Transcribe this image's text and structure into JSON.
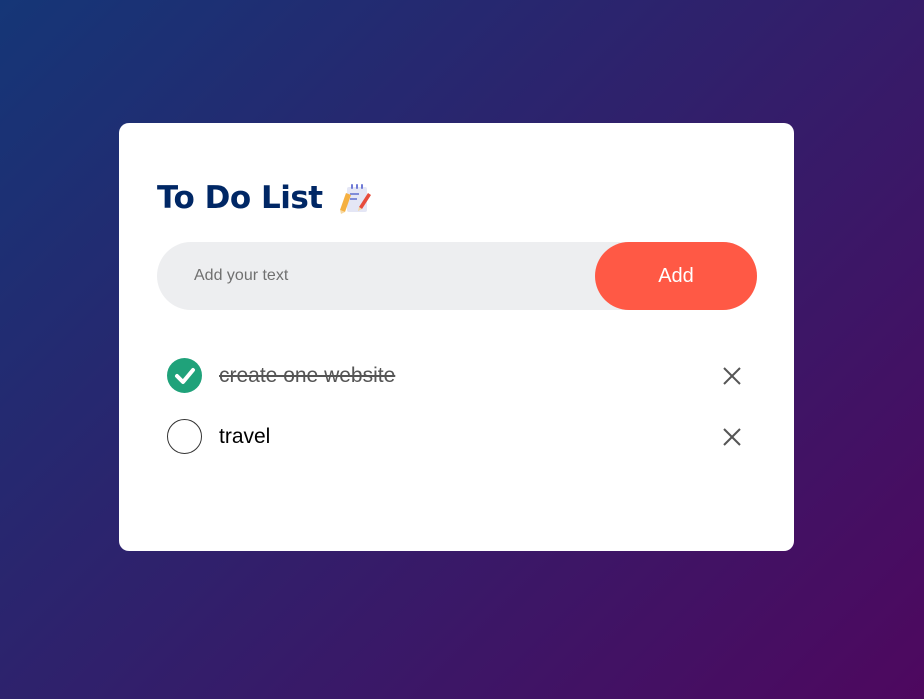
{
  "app": {
    "title": "To Do List",
    "title_icon": "notepad-pencil-icon"
  },
  "input": {
    "placeholder": "Add your text",
    "value": ""
  },
  "add_button": {
    "label": "Add"
  },
  "tasks": [
    {
      "text": "create one website",
      "checked": true
    },
    {
      "text": "travel",
      "checked": false
    }
  ],
  "colors": {
    "background_start": "#153677",
    "background_end": "#4e085f",
    "title": "#002765",
    "accent": "#ff5945",
    "check": "#1fa27a",
    "input_bg": "#edeef0"
  }
}
